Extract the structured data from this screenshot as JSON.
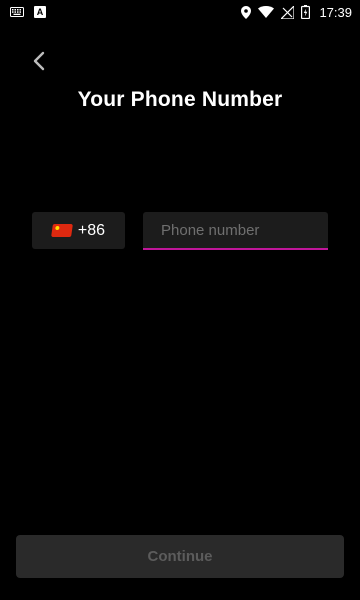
{
  "status_bar": {
    "time": "17:39",
    "left_icons": [
      "keyboard-icon",
      "a-badge-icon"
    ],
    "right_icons": [
      "location-icon",
      "wifi-icon",
      "signal-icon",
      "battery-charging-icon"
    ],
    "a_badge_text": "A"
  },
  "header": {
    "back_icon": "chevron-left-icon",
    "title": "Your Phone Number"
  },
  "phone_form": {
    "country_code": "+86",
    "country_flag": "china-flag-icon",
    "phone_value": "",
    "phone_placeholder": "Phone number",
    "accent_color": "#c0169a"
  },
  "footer": {
    "continue_label": "Continue",
    "continue_enabled": false
  }
}
